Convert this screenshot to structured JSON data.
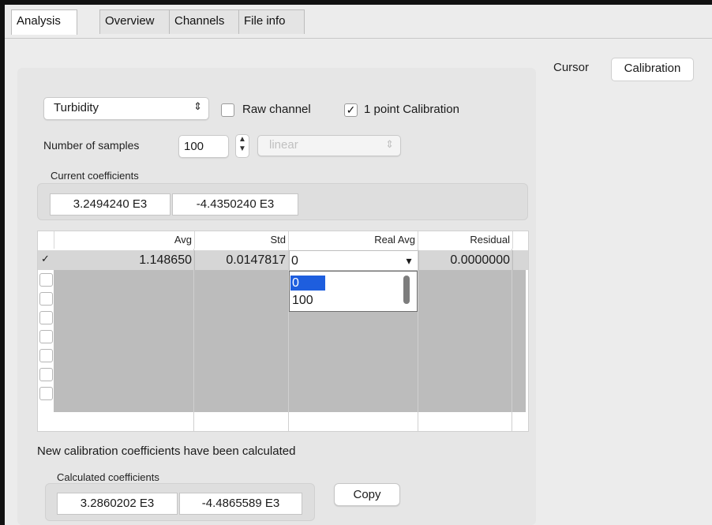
{
  "tabs": [
    "Analysis",
    "Overview",
    "Channels",
    "File info"
  ],
  "subtabs": {
    "cursor": "Cursor",
    "calibration": "Calibration"
  },
  "controls": {
    "channel_select": "Turbidity",
    "raw_channel_label": "Raw channel",
    "raw_channel_checked": false,
    "one_point_label": "1 point Calibration",
    "one_point_checked": true,
    "samples_label": "Number of samples",
    "samples_value": "100",
    "mode_select": "linear"
  },
  "current": {
    "title": "Current coefficients",
    "values": [
      "3.2494240 E3",
      "-4.4350240 E3"
    ]
  },
  "table": {
    "headers": [
      "Avg",
      "Std",
      "Real Avg",
      "Residual"
    ],
    "row1": {
      "avg": "1.148650",
      "std": "0.0147817",
      "real_avg": "0",
      "residual": "0.0000000",
      "checked": "✓"
    },
    "dropdown_options": [
      "0",
      "100"
    ]
  },
  "status_message": "New calibration coefficients have been calculated",
  "calculated": {
    "title": "Calculated coefficients",
    "values": [
      "3.2860202 E3",
      "-4.4865589 E3"
    ],
    "copy_label": "Copy"
  },
  "icons": {
    "updown": "⇕",
    "check": "✓",
    "down_triangle": "▾"
  }
}
